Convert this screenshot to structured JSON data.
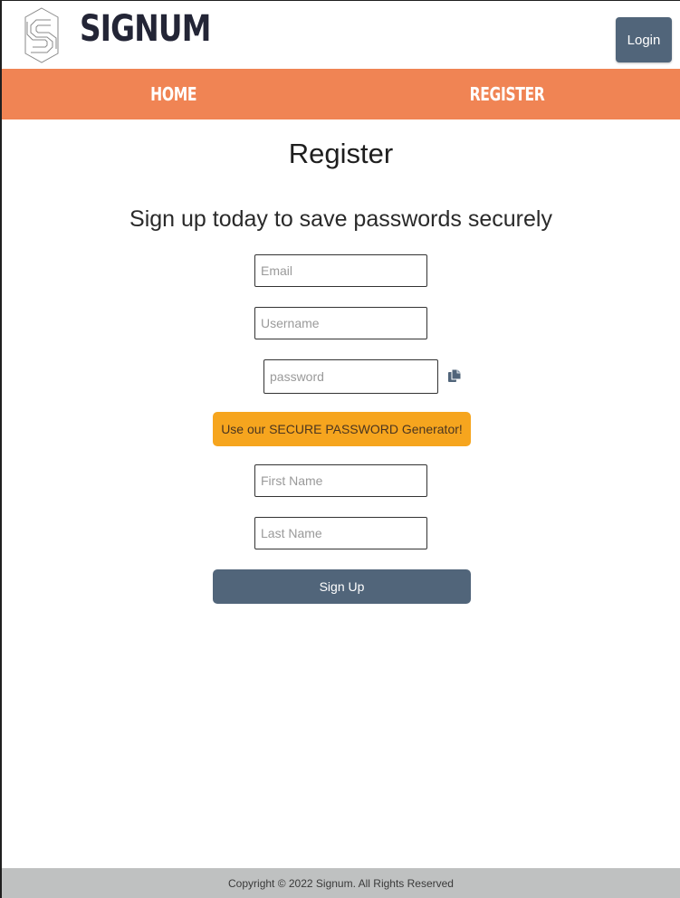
{
  "header": {
    "brand": "SIGNUM",
    "login_label": "Login"
  },
  "nav": {
    "items": [
      {
        "label": "HOME"
      },
      {
        "label": "REGISTER"
      }
    ]
  },
  "main": {
    "title": "Register",
    "subtitle": "Sign up today to save passwords securely",
    "fields": {
      "email": {
        "placeholder": "Email",
        "value": ""
      },
      "username": {
        "placeholder": "Username",
        "value": ""
      },
      "password": {
        "placeholder": "password",
        "value": ""
      },
      "first_name": {
        "placeholder": "First Name",
        "value": ""
      },
      "last_name": {
        "placeholder": "Last Name",
        "value": ""
      }
    },
    "generator_label": "Use our SECURE PASSWORD Generator!",
    "signup_label": "Sign Up"
  },
  "footer": {
    "copyright": "Copyright © 2022 Signum. All Rights Reserved"
  },
  "icons": {
    "logo": "signum-s-logo-icon",
    "copy": "copy-icon"
  },
  "colors": {
    "nav_bg": "#f08454",
    "button_slate": "#51657a",
    "generator_orange": "#f6a51e",
    "footer_bg": "#bfc1c1",
    "brand_text": "#232536"
  }
}
